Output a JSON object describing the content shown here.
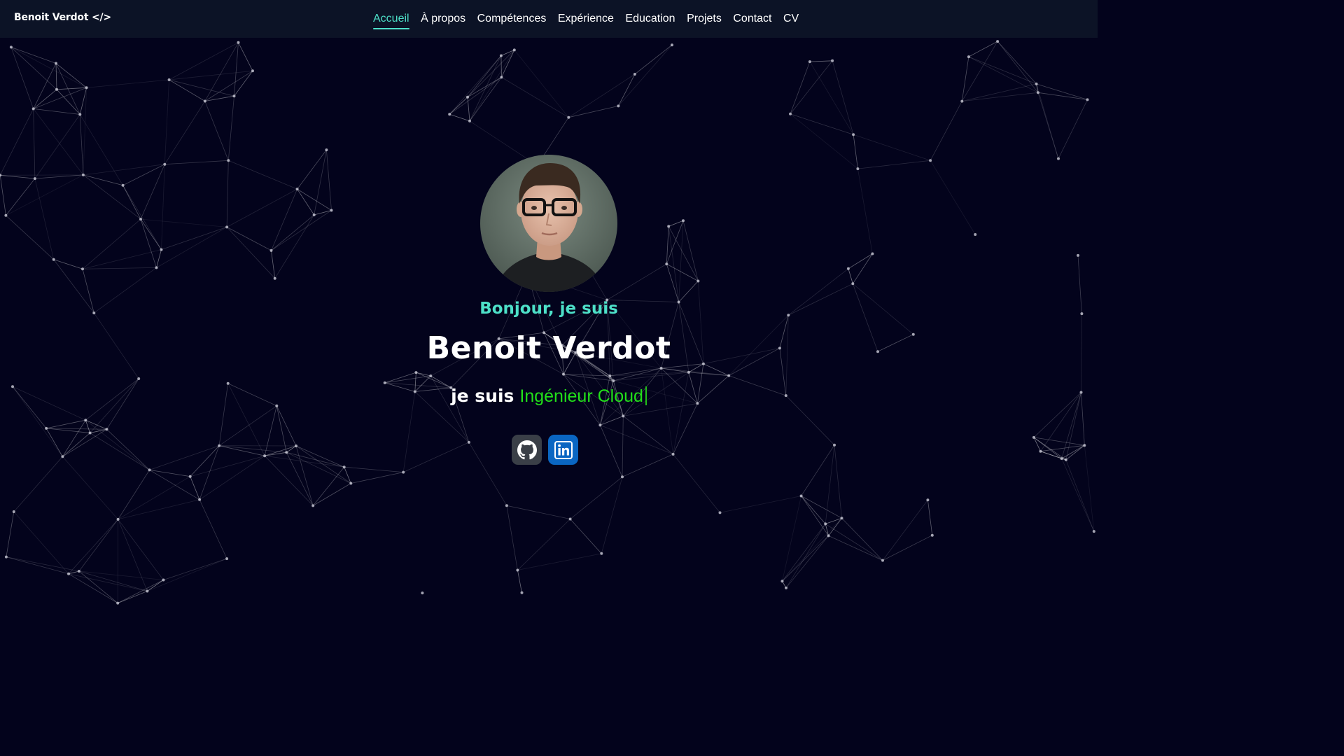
{
  "navbar": {
    "brand": "Benoit Verdot </>",
    "links": [
      {
        "label": "Accueil",
        "active": true
      },
      {
        "label": "À propos"
      },
      {
        "label": "Compétences"
      },
      {
        "label": "Expérience"
      },
      {
        "label": "Education"
      },
      {
        "label": "Projets"
      },
      {
        "label": "Contact"
      },
      {
        "label": "CV"
      }
    ]
  },
  "hero": {
    "greeting": "Bonjour, je suis",
    "name": "Benoit Verdot",
    "tagline_prefix": "je suis",
    "tagline_role": "Ingénieur Cloud",
    "avatar_icon": "profile-photo"
  },
  "socials": [
    {
      "name": "github",
      "icon": "github-icon"
    },
    {
      "name": "linkedin",
      "icon": "linkedin-icon"
    }
  ],
  "colors": {
    "background": "#03031c",
    "navbar": "#0c1326",
    "accent": "#4de0c8",
    "role": "#22e01a",
    "github_button": "#3a3f47",
    "linkedin_button": "#0a66c2"
  }
}
